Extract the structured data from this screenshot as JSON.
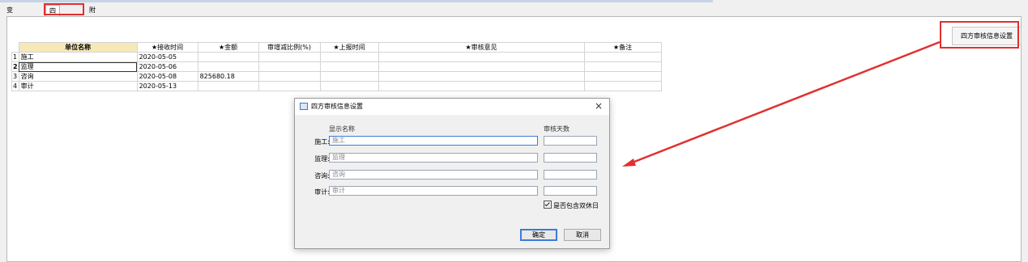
{
  "tabs": [
    "变更费用",
    "四方审核",
    "附件"
  ],
  "toolbar": {
    "settings_label": "四方审核信息设置"
  },
  "grid": {
    "columns": [
      "单位名称",
      "★接收时间",
      "★金额",
      "审增减比例(%)",
      "★上报时间",
      "★审核意见",
      "★备注"
    ],
    "rows": [
      {
        "n": "1",
        "name": "施工",
        "recv": "2020-05-05",
        "amount": "",
        "ratio": "",
        "report": "",
        "opinion": "",
        "note": ""
      },
      {
        "n": "2",
        "name": "监理",
        "recv": "2020-05-06",
        "amount": "",
        "ratio": "",
        "report": "",
        "opinion": "",
        "note": ""
      },
      {
        "n": "3",
        "name": "咨询",
        "recv": "2020-05-08",
        "amount": "825680.18",
        "ratio": "",
        "report": "",
        "opinion": "",
        "note": ""
      },
      {
        "n": "4",
        "name": "审计",
        "recv": "2020-05-13",
        "amount": "",
        "ratio": "",
        "report": "",
        "opinion": "",
        "note": ""
      }
    ]
  },
  "dialog": {
    "title": "四方审核信息设置",
    "close": "×",
    "col_name": "显示名称",
    "col_days": "审核天数",
    "fields": [
      {
        "label": "施工:",
        "placeholder": "施工"
      },
      {
        "label": "监理:",
        "placeholder": "监理"
      },
      {
        "label": "咨询:",
        "placeholder": "咨询"
      },
      {
        "label": "审计:",
        "placeholder": "审计"
      }
    ],
    "checkbox_label": "是否包含双休日",
    "checkbox_checked": true,
    "ok": "确定",
    "cancel": "取消"
  },
  "colors": {
    "highlight_red": "#e03030",
    "header_yellow": "#f7e8b8",
    "focus_blue": "#3d7bd8"
  }
}
